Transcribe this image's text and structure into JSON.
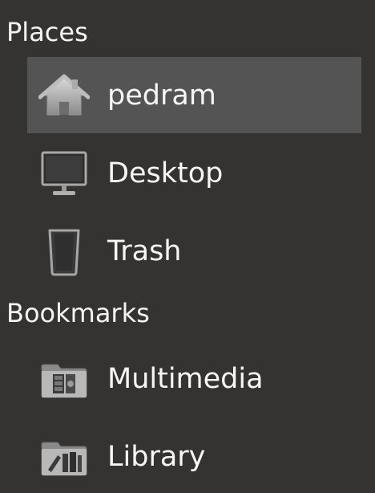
{
  "places": {
    "header": "Places",
    "items": [
      {
        "label": "pedram",
        "icon": "home-icon",
        "selected": true
      },
      {
        "label": "Desktop",
        "icon": "desktop-icon",
        "selected": false
      },
      {
        "label": "Trash",
        "icon": "trash-icon",
        "selected": false
      }
    ]
  },
  "bookmarks": {
    "header": "Bookmarks",
    "items": [
      {
        "label": "Multimedia",
        "icon": "multimedia-folder-icon"
      },
      {
        "label": "Library",
        "icon": "library-folder-icon"
      }
    ]
  },
  "colors": {
    "background": "#353331",
    "selected_row": "#545454",
    "text": "#f6f6f6"
  }
}
